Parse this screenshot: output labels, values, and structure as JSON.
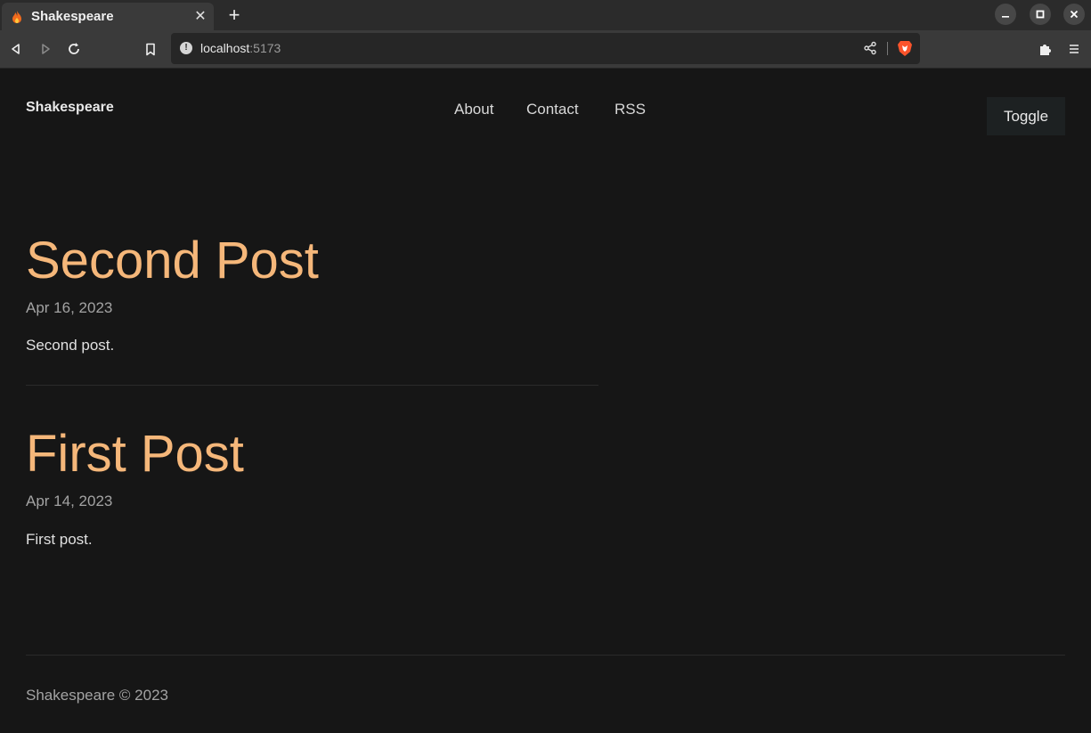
{
  "browser": {
    "tab_title": "Shakespeare",
    "url_host": "localhost",
    "url_port": ":5173"
  },
  "site": {
    "brand": "Shakespeare",
    "nav": [
      "About",
      "Contact",
      "RSS"
    ],
    "toggle_label": "Toggle"
  },
  "posts": [
    {
      "title": "Second Post",
      "date": "Apr 16, 2023",
      "description": "Second post."
    },
    {
      "title": "First Post",
      "date": "Apr 14, 2023",
      "description": "First post."
    }
  ],
  "footer": {
    "text": "Shakespeare © 2023"
  },
  "colors": {
    "accent": "#f5b77a",
    "background": "#161616"
  }
}
